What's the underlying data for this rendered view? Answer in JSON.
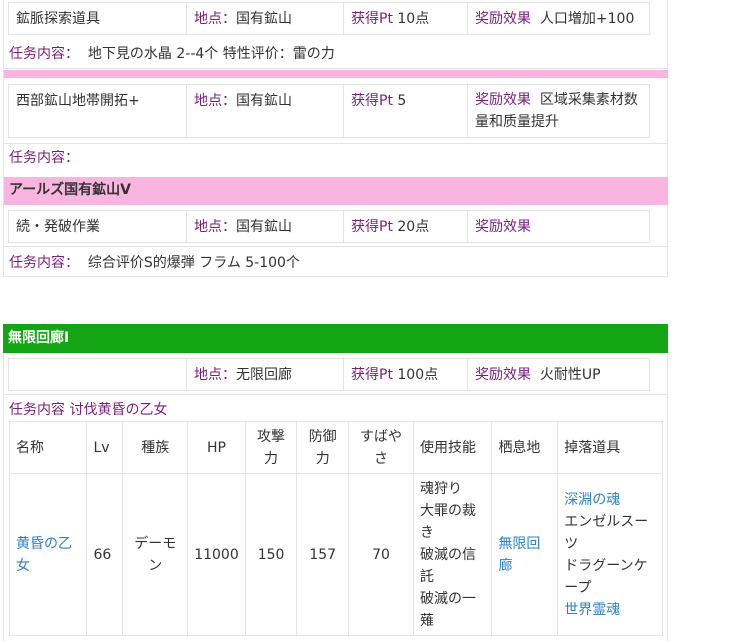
{
  "tasks": [
    {
      "name": "鉱脈探索道具",
      "location_label": "地点：",
      "location": "国有鉱山",
      "pt_label": "获得Pt",
      "pt": "10点",
      "reward_label": "奖励效果",
      "reward": "人口増加+100",
      "content_label": "任务内容：",
      "content": "地下見の水晶 2--4个 特性评价：雷の力"
    },
    {
      "name": "西部鉱山地帯開拓+",
      "location_label": "地点：",
      "location": "国有鉱山",
      "pt_label": "获得Pt",
      "pt": "5",
      "reward_label": "奖励效果",
      "reward": "区域采集素材数量和质量提升",
      "content_label": "任务内容：",
      "content": ""
    },
    {
      "name": "続・発破作業",
      "location_label": "地点：",
      "location": "国有鉱山",
      "pt_label": "获得Pt",
      "pt": "20点",
      "reward_label": "奖励效果",
      "reward": "",
      "content_label": "任务内容：",
      "content": "综合评价S的爆弾 フラム 5-100个"
    }
  ],
  "section_arls": {
    "title": "アールズ国有鉱山V"
  },
  "section_mugen": {
    "title": "無限回廊I",
    "location_label": "地点：",
    "location": "无限回廊",
    "pt_label": "获得Pt",
    "pt": "100点",
    "reward_label": "奖励效果",
    "reward": "火耐性UP",
    "content": "任务内容 讨伐黄昏の乙女"
  },
  "monster_table": {
    "headers": [
      "名称",
      "Lv",
      "種族",
      "HP",
      "攻撃力",
      "防御力",
      "すばやさ",
      "使用技能",
      "栖息地",
      "掉落道具"
    ],
    "row": {
      "name": "黄昏の乙女",
      "lv": "66",
      "race": "デーモン",
      "hp": "11000",
      "atk": "150",
      "def": "157",
      "spd": "70",
      "skills": [
        "魂狩り",
        "大罪の裁き",
        "破滅の信託",
        "破滅の一薙"
      ],
      "habitat": "無限回廊",
      "drops": [
        "深淵の魂",
        "エンゼルスーツ",
        "ドラグーンケープ",
        "世界霊魂"
      ]
    }
  },
  "colors": {
    "purple": "#7b1d7e",
    "link_blue": "#2a82c9",
    "pink": "#f9b4df",
    "green": "#14a514"
  }
}
